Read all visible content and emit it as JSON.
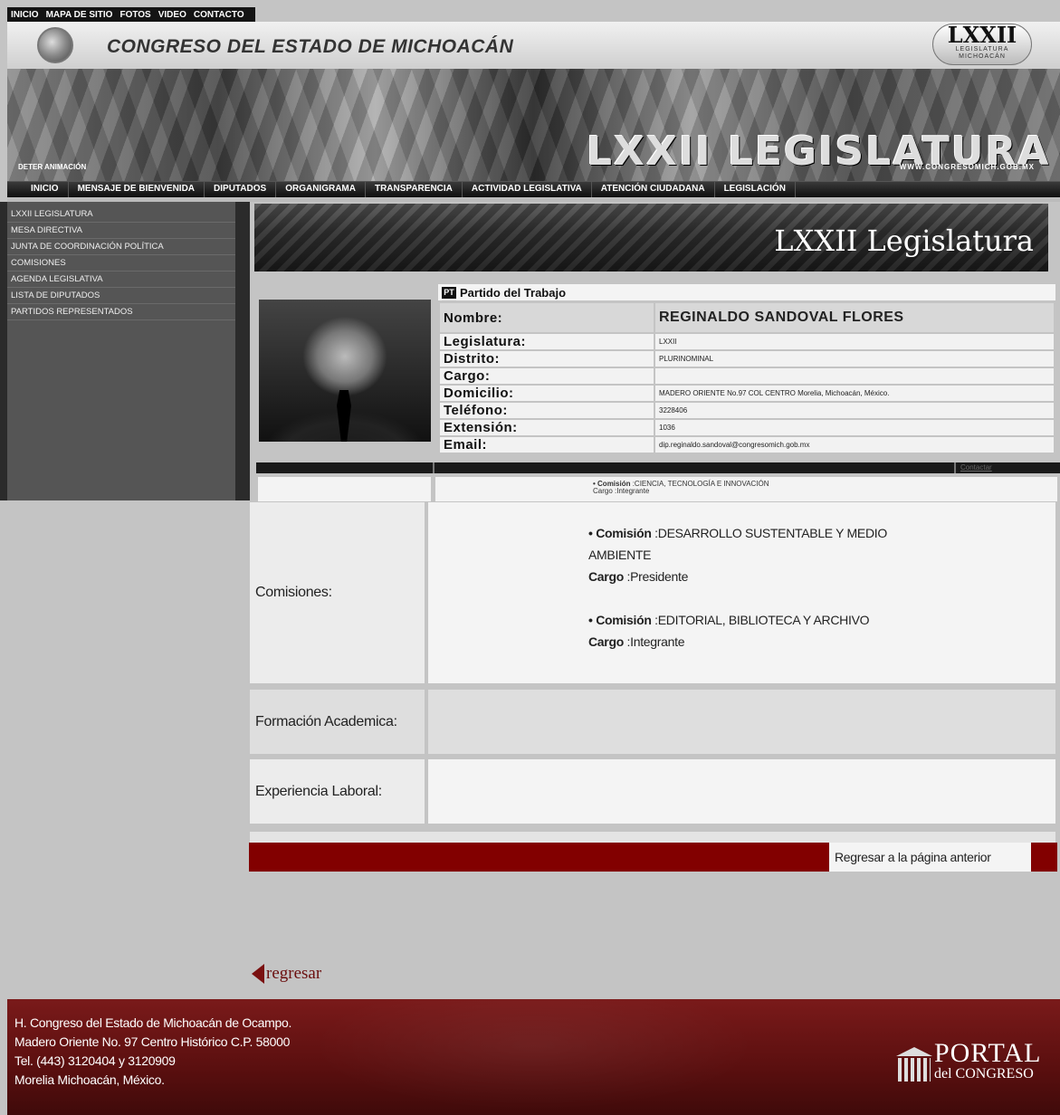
{
  "top_links": [
    "INICIO",
    "MAPA DE SITIO",
    "FOTOS",
    "VIDEO",
    "CONTACTO"
  ],
  "header": {
    "title": "CONGRESO DEL ESTADO DE MICHOACÁN",
    "logo_big": "LXXII",
    "logo_small_1": "LEGISLATURA",
    "logo_small_2": "MICHOACÁN",
    "banner": "LXXII LEGISLATURA",
    "deter": "DETER ANIMACIÓN",
    "url": "WWW.CONGRESOMICH.GOB.MX"
  },
  "main_nav": [
    "INICIO",
    "MENSAJE DE BIENVENIDA",
    "DIPUTADOS",
    "ORGANIGRAMA",
    "TRANSPARENCIA",
    "ACTIVIDAD LEGISLATIVA",
    "ATENCIÓN CIUDADANA",
    "LEGISLACIÓN"
  ],
  "left_menu": [
    "LXXII LEGISLATURA",
    "MESA DIRECTIVA",
    "JUNTA DE COORDINACIÓN POLÍTICA",
    "COMISIONES",
    "AGENDA LEGISLATIVA",
    "LISTA DE DIPUTADOS",
    "PARTIDOS REPRESENTADOS"
  ],
  "legislatura_banner": "LXXII Legislatura",
  "party": {
    "logo": "PT",
    "name": "Partido del Trabajo"
  },
  "profile": {
    "name_label": "Nombre:",
    "name": "REGINALDO SANDOVAL FLORES",
    "rows": [
      {
        "label": "Legislatura:",
        "value": "LXXII"
      },
      {
        "label": "Distrito:",
        "value": "PLURINOMINAL"
      },
      {
        "label": "Cargo:",
        "value": ""
      },
      {
        "label": "Domicilio:",
        "value": "MADERO ORIENTE No.97 COL CENTRO Morelia, Michoacán, México."
      },
      {
        "label": "Teléfono:",
        "value": "3228406"
      },
      {
        "label": "Extensión:",
        "value": "1036"
      },
      {
        "label": "Email:",
        "value": "dip.reginaldo.sandoval@congresomich.gob.mx"
      }
    ]
  },
  "contactar": "Contactar",
  "commission_small": {
    "line1_label": "• Comisión",
    "line1_value": " :CIENCIA, TECNOLOGÍA E INNOVACIÓN",
    "line2": "Cargo :Integrante"
  },
  "comisiones": {
    "label": "Comisiones:",
    "entries": [
      {
        "comision_label": "• Comisión",
        "comision": " :DESARROLLO SUSTENTABLE Y MEDIO AMBIENTE",
        "cargo_label": "Cargo",
        "cargo": " :Presidente"
      },
      {
        "comision_label": "• Comisión",
        "comision": " :EDITORIAL, BIBLIOTECA Y ARCHIVO",
        "cargo_label": "Cargo",
        "cargo": " :Integrante"
      }
    ]
  },
  "formacion": {
    "label": "Formación Academica:"
  },
  "experiencia": {
    "label": "Experiencia Laboral:"
  },
  "back_button": "Regresar a la página anterior",
  "regresar": "regresar",
  "footer": {
    "lines": [
      "H. Congreso del Estado de Michoacán de Ocampo.",
      "Madero Oriente No. 97 Centro Histórico C.P. 58000",
      "Tel. (443) 3120404 y 3120909",
      "Morelia Michoacán, México."
    ],
    "portal_big": "PORTAL",
    "portal_small": "del CONGRESO"
  }
}
